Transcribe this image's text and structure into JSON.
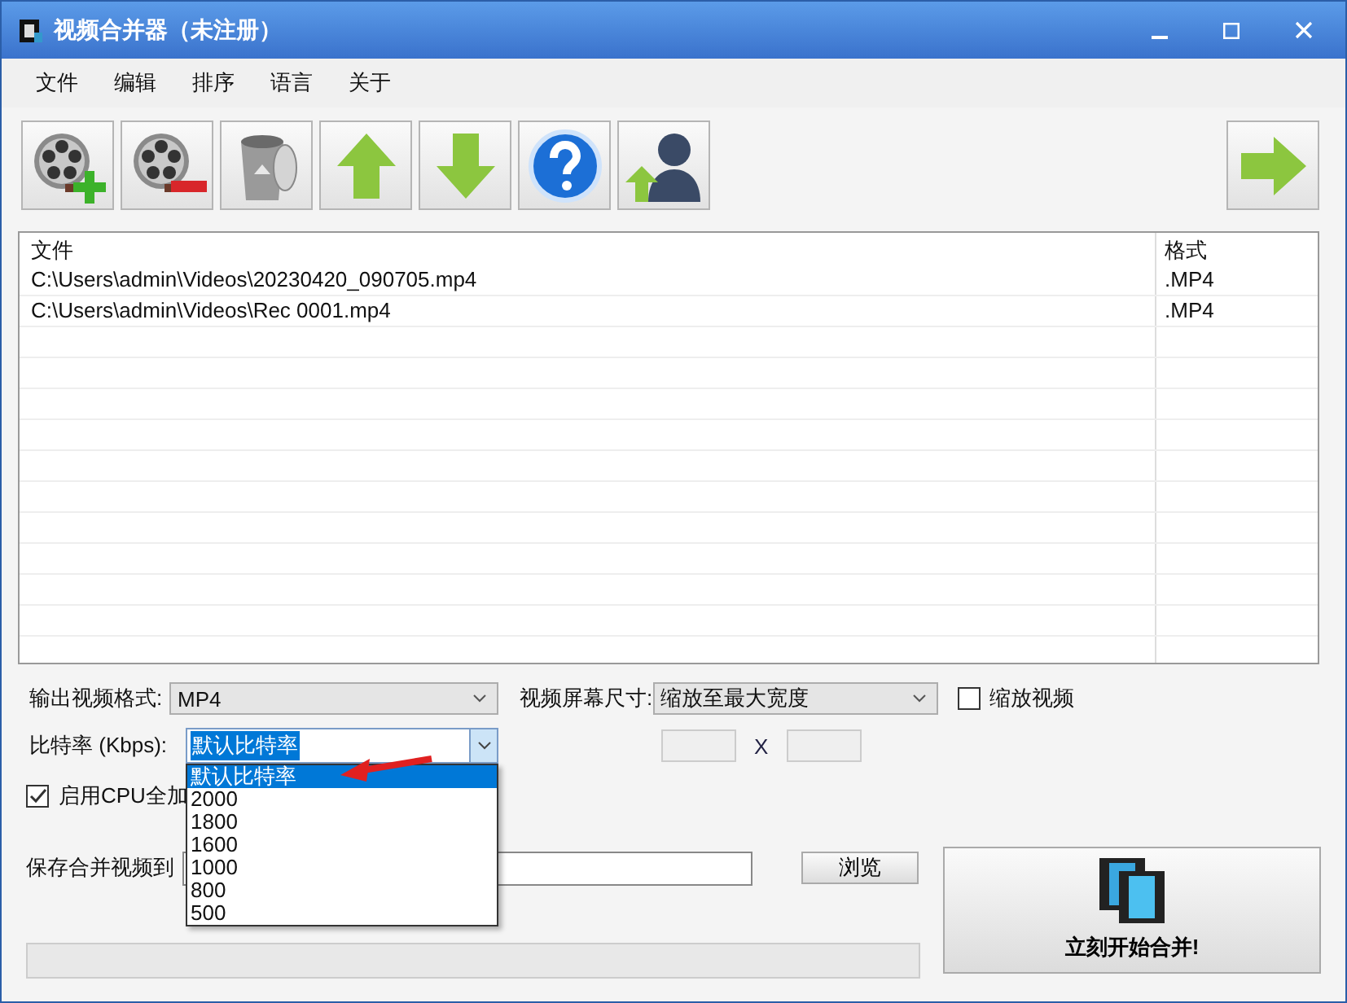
{
  "window": {
    "title": "视频合并器（未注册）"
  },
  "menu": [
    "文件",
    "编辑",
    "排序",
    "语言",
    "关于"
  ],
  "toolbar": [
    {
      "kind": "add"
    },
    {
      "kind": "remove"
    },
    {
      "kind": "trash"
    },
    {
      "kind": "up"
    },
    {
      "kind": "down"
    },
    {
      "kind": "help"
    },
    {
      "kind": "user"
    }
  ],
  "file_list": {
    "columns": [
      "文件",
      "格式"
    ],
    "rows": [
      {
        "file": "C:\\Users\\admin\\Videos\\20230420_090705.mp4",
        "format": ".MP4"
      },
      {
        "file": "C:\\Users\\admin\\Videos\\Rec 0001.mp4",
        "format": ".MP4"
      }
    ]
  },
  "output_format": {
    "label": "输出视频格式:",
    "value": "MP4"
  },
  "screen_size": {
    "label": "视频屏幕尺寸:",
    "value": "缩放至最大宽度"
  },
  "scale_video": {
    "label": "缩放视频",
    "checked": false
  },
  "bitrate": {
    "label": "比特率 (Kbps):",
    "value": "默认比特率",
    "expanded": true,
    "options": [
      {
        "label": "默认比特率",
        "selected": true
      },
      {
        "label": "2000",
        "selected": false
      },
      {
        "label": "1800",
        "selected": false
      },
      {
        "label": "1600",
        "selected": false
      },
      {
        "label": "1000",
        "selected": false
      },
      {
        "label": "800",
        "selected": false
      },
      {
        "label": "500",
        "selected": false
      }
    ]
  },
  "size_separator": "X",
  "cpu": {
    "label": "启用CPU全加",
    "checked": true
  },
  "save": {
    "label": "保存合并视频到",
    "browse": "浏览"
  },
  "progress": {
    "level": 0
  },
  "start": {
    "label": "立刻开始合并!"
  }
}
